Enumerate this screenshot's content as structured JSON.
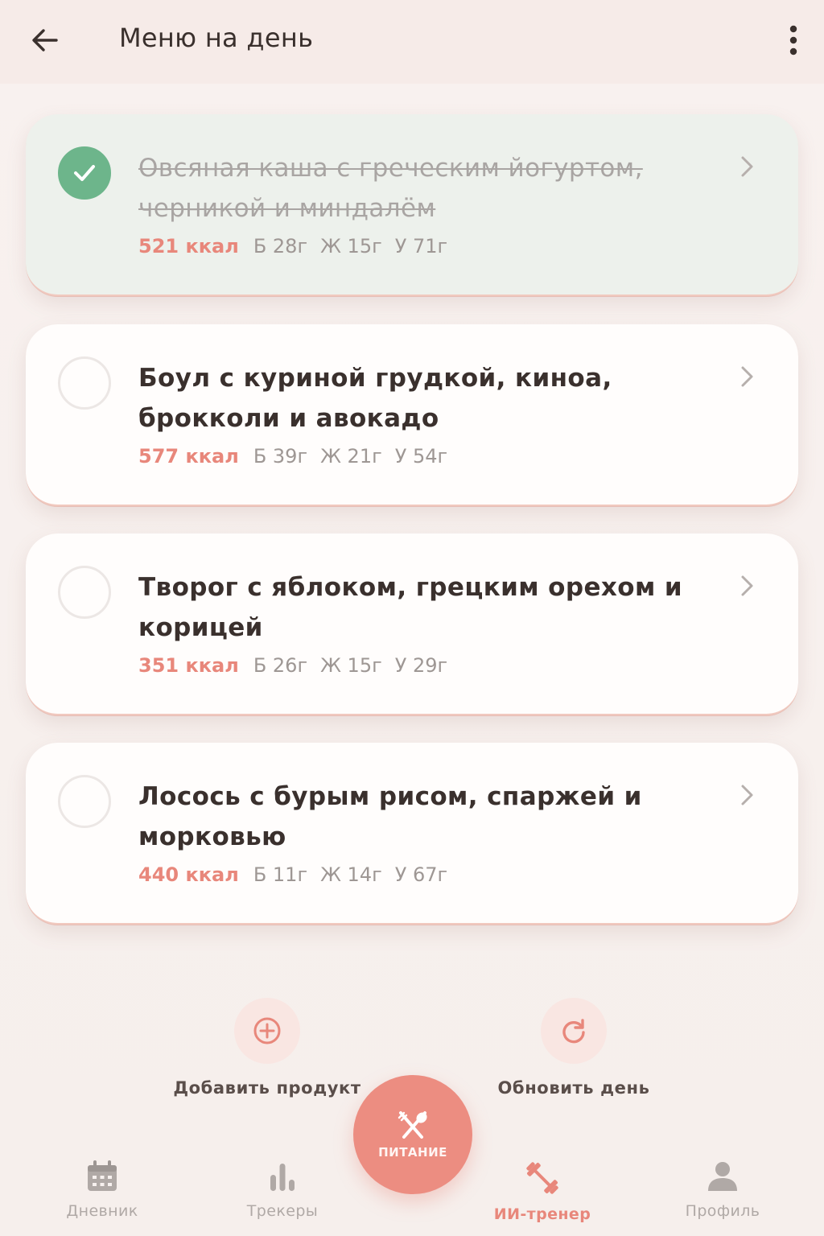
{
  "header": {
    "title": "Меню на день",
    "back_icon": "arrow-left-icon",
    "more_icon": "more-vertical-icon"
  },
  "meals": [
    {
      "title": "Овсяная каша с греческим йогуртом, черникой и миндалём",
      "kcal": "521 ккал",
      "protein": "Б 28г",
      "fat": "Ж 15г",
      "carbs": "У 71г",
      "done": true
    },
    {
      "title": "Боул с куриной грудкой, киноа, брокколи и авокадо",
      "kcal": "577 ккал",
      "protein": "Б 39г",
      "fat": "Ж 21г",
      "carbs": "У 54г",
      "done": false
    },
    {
      "title": "Творог с яблоком, грецким орехом и корицей",
      "kcal": "351 ккал",
      "protein": "Б 26г",
      "fat": "Ж 15г",
      "carbs": "У 29г",
      "done": false
    },
    {
      "title": "Лосось с бурым рисом, спаржей и морковью",
      "kcal": "440 ккал",
      "protein": "Б 11г",
      "fat": "Ж 14г",
      "carbs": "У 67г",
      "done": false
    }
  ],
  "actions": {
    "add_label": "Добавить продукт",
    "refresh_label": "Обновить день"
  },
  "nav": {
    "diary": "Дневник",
    "trackers": "Трекеры",
    "fab": "ПИТАНИЕ",
    "coach": "ИИ-тренер",
    "profile": "Профиль"
  },
  "colors": {
    "accent": "#e8877b",
    "done_green": "#6db58b",
    "background": "#f7f1ef"
  }
}
